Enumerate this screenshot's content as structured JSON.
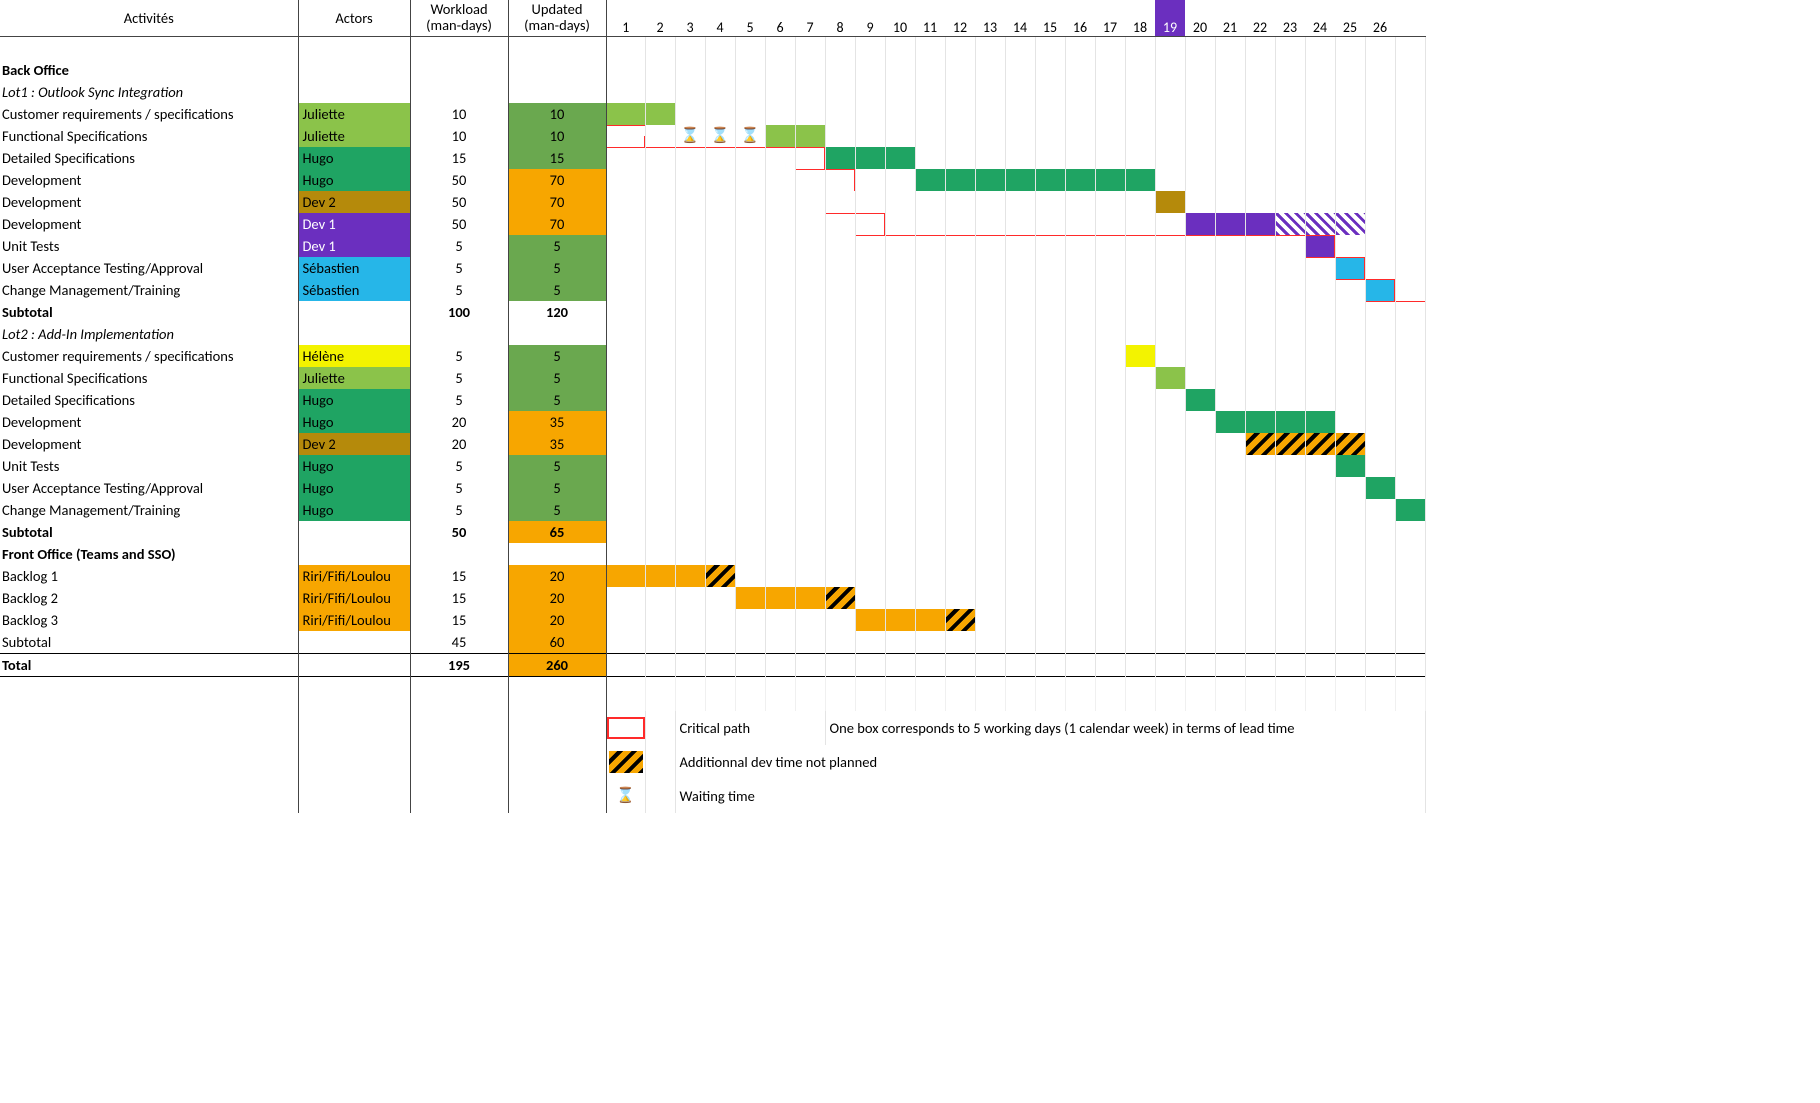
{
  "headers": {
    "activities": "Activités",
    "actors": "Actors",
    "workload": "Workload\n(man-days)",
    "updated": "Updated\n(man-days)"
  },
  "weeks": [
    "1",
    "2",
    "3",
    "4",
    "5",
    "6",
    "7",
    "8",
    "9",
    "10",
    "11",
    "12",
    "13",
    "14",
    "15",
    "16",
    "17",
    "18",
    "19",
    "20",
    "21",
    "22",
    "23",
    "24",
    "25",
    "26"
  ],
  "highlight_week_index": 18,
  "hourglass": "⌛",
  "actor_colors": {
    "Juliette": "c-lg",
    "Hugo": "c-g",
    "Dev 2": "c-ol",
    "Dev 1": "c-pu",
    "Sébastien": "c-cy",
    "Hélène": "c-ye",
    "Riri/Fifi/Loulou": "c-or"
  },
  "rows": [
    {
      "style": "empty"
    },
    {
      "style": "b",
      "act": "Back Office"
    },
    {
      "style": "i",
      "act": "Lot1 : Outlook Sync Integration"
    },
    {
      "act": "Customer requirements / specifications",
      "actor": "Juliette",
      "wl": "10",
      "upd": "10",
      "upd_bg": "c-mg",
      "bars": [
        {
          "start": 1,
          "end": 2,
          "cls": "c-lg"
        }
      ]
    },
    {
      "act": "Functional Specifications",
      "actor": "Juliette",
      "wl": "10",
      "upd": "10",
      "upd_bg": "c-mg",
      "bars": [
        {
          "start": 6,
          "end": 7,
          "cls": "c-lg"
        }
      ],
      "hourglass": [
        3,
        4,
        5
      ],
      "crit_start": 1
    },
    {
      "act": "Detailed Specifications",
      "actor": "Hugo",
      "wl": "15",
      "upd": "15",
      "upd_bg": "c-mg",
      "bars": [
        {
          "start": 8,
          "end": 10,
          "cls": "c-g"
        }
      ],
      "crit_h": {
        "from": 1,
        "to": 7
      },
      "crit_v": 7
    },
    {
      "act": "Development",
      "actor": "Hugo",
      "wl": "50",
      "upd": "70",
      "upd_bg": "c-or",
      "bars": [
        {
          "start": 11,
          "end": 18,
          "cls": "c-g"
        }
      ],
      "crit_h": {
        "from": 7,
        "to": 8
      },
      "crit_v": 8
    },
    {
      "act": "Development",
      "actor": "Dev 2",
      "wl": "50",
      "upd": "70",
      "upd_bg": "c-or",
      "bars": [
        {
          "start": 19,
          "end": 19,
          "cls": "c-ol"
        }
      ]
    },
    {
      "act": "Development",
      "actor": "Dev 1",
      "wl": "50",
      "upd": "70",
      "upd_bg": "c-or",
      "bars": [
        {
          "start": 20,
          "end": 22,
          "cls": "c-pu"
        },
        {
          "start": 23,
          "end": 25,
          "cls": "hatch-p"
        }
      ],
      "crit_h": {
        "from": 8,
        "to": 9
      },
      "crit_v": 9
    },
    {
      "act": "Unit Tests",
      "actor": "Dev 1",
      "wl": "5",
      "upd": "5",
      "upd_bg": "c-mg",
      "bars": [
        {
          "start": 24,
          "end": 24,
          "cls": "c-pu"
        }
      ],
      "crit_h": {
        "from": 9,
        "to": 24
      },
      "crit_v": 24
    },
    {
      "act": "User Acceptance Testing/Approval",
      "actor": "Sébastien",
      "wl": "5",
      "upd": "5",
      "upd_bg": "c-mg",
      "bars": [
        {
          "start": 25,
          "end": 25,
          "cls": "c-cy"
        }
      ],
      "crit_h": {
        "from": 24,
        "to": 25
      },
      "crit_v": 25
    },
    {
      "act": "Change Management/Training",
      "actor": "Sébastien",
      "wl": "5",
      "upd": "5",
      "upd_bg": "c-mg",
      "bars": [
        {
          "start": 26,
          "end": 26,
          "cls": "c-cy"
        }
      ],
      "crit_h": {
        "from": 25,
        "to": 26
      },
      "crit_v": 26
    },
    {
      "style": "b",
      "act": "Subtotal",
      "wl": "100",
      "upd": "120",
      "crit_h": {
        "from": 26,
        "to": 27
      }
    },
    {
      "style": "i",
      "act": "Lot2 : Add-In Implementation"
    },
    {
      "act": "Customer requirements / specifications",
      "actor": "Hélène",
      "wl": "5",
      "upd": "5",
      "upd_bg": "c-mg",
      "bars": [
        {
          "start": 18,
          "end": 18,
          "cls": "c-ye"
        }
      ]
    },
    {
      "act": "Functional Specifications",
      "actor": "Juliette",
      "wl": "5",
      "upd": "5",
      "upd_bg": "c-mg",
      "bars": [
        {
          "start": 19,
          "end": 19,
          "cls": "c-lg"
        }
      ]
    },
    {
      "act": "Detailed Specifications",
      "actor": "Hugo",
      "wl": "5",
      "upd": "5",
      "upd_bg": "c-mg",
      "bars": [
        {
          "start": 20,
          "end": 20,
          "cls": "c-g"
        }
      ]
    },
    {
      "act": "Development",
      "actor": "Hugo",
      "wl": "20",
      "upd": "35",
      "upd_bg": "c-or",
      "bars": [
        {
          "start": 21,
          "end": 24,
          "cls": "c-g"
        }
      ]
    },
    {
      "act": "Development",
      "actor": "Dev 2",
      "wl": "20",
      "upd": "35",
      "upd_bg": "c-or",
      "bars": [
        {
          "start": 22,
          "end": 25,
          "cls": "hatch-y"
        }
      ]
    },
    {
      "act": "Unit Tests",
      "actor": "Hugo",
      "wl": "5",
      "upd": "5",
      "upd_bg": "c-mg",
      "bars": [
        {
          "start": 25,
          "end": 25,
          "cls": "c-g"
        }
      ]
    },
    {
      "act": "User Acceptance Testing/Approval",
      "actor": "Hugo",
      "wl": "5",
      "upd": "5",
      "upd_bg": "c-mg",
      "bars": [
        {
          "start": 26,
          "end": 26,
          "cls": "c-g"
        }
      ]
    },
    {
      "act": "Change Management/Training",
      "actor": "Hugo",
      "wl": "5",
      "upd": "5",
      "upd_bg": "c-mg",
      "bars": [
        {
          "start": 27,
          "end": 27,
          "cls": "c-g"
        }
      ]
    },
    {
      "style": "b",
      "act": "Subtotal",
      "wl": "50",
      "upd": "65",
      "upd_bg": "c-or"
    },
    {
      "style": "b",
      "act": "Front Office (Teams and SSO)"
    },
    {
      "act": "Backlog 1",
      "actor": "Riri/Fifi/Loulou",
      "wl": "15",
      "upd": "20",
      "upd_bg": "c-or",
      "bars": [
        {
          "start": 1,
          "end": 3,
          "cls": "c-or"
        },
        {
          "start": 4,
          "end": 4,
          "cls": "hatch-y"
        }
      ]
    },
    {
      "act": "Backlog 2",
      "actor": "Riri/Fifi/Loulou",
      "wl": "15",
      "upd": "20",
      "upd_bg": "c-or",
      "bars": [
        {
          "start": 5,
          "end": 7,
          "cls": "c-or"
        },
        {
          "start": 8,
          "end": 8,
          "cls": "hatch-y"
        }
      ]
    },
    {
      "act": "Backlog 3",
      "actor": "Riri/Fifi/Loulou",
      "wl": "15",
      "upd": "20",
      "upd_bg": "c-or",
      "bars": [
        {
          "start": 9,
          "end": 11,
          "cls": "c-or"
        },
        {
          "start": 12,
          "end": 12,
          "cls": "hatch-y"
        }
      ]
    },
    {
      "act": "Subtotal",
      "wl": "45",
      "upd": "60",
      "upd_bg": "c-or"
    },
    {
      "style": "b",
      "act": "Total",
      "wl": "195",
      "upd": "260",
      "upd_bg": "c-or",
      "topline": true
    }
  ],
  "legend": {
    "critical": "Critical path",
    "notes": "One box corresponds to 5 working days (1 calendar week) in terms of lead time",
    "additional": "Additionnal dev time not planned",
    "waiting": "Waiting time"
  },
  "chart_data": {
    "type": "gantt",
    "title": "",
    "x_unit": "week (1 box = 5 working days)",
    "columns": [
      "Activités",
      "Actors",
      "Workload (man-days)",
      "Updated (man-days)"
    ],
    "highlight_week": 19,
    "groups": [
      {
        "name": "Back Office",
        "lots": [
          {
            "name": "Lot1 : Outlook Sync Integration",
            "tasks": [
              {
                "name": "Customer requirements / specifications",
                "actor": "Juliette",
                "workload": 10,
                "updated": 10,
                "bars": [
                  {
                    "from": 1,
                    "to": 2,
                    "kind": "plan"
                  }
                ]
              },
              {
                "name": "Functional Specifications",
                "actor": "Juliette",
                "workload": 10,
                "updated": 10,
                "bars": [
                  {
                    "from": 6,
                    "to": 7,
                    "kind": "plan"
                  }
                ],
                "waiting": [
                  3,
                  4,
                  5
                ]
              },
              {
                "name": "Detailed Specifications",
                "actor": "Hugo",
                "workload": 15,
                "updated": 15,
                "bars": [
                  {
                    "from": 8,
                    "to": 10,
                    "kind": "plan"
                  }
                ]
              },
              {
                "name": "Development",
                "actor": "Hugo",
                "workload": 50,
                "updated": 70,
                "bars": [
                  {
                    "from": 11,
                    "to": 18,
                    "kind": "plan"
                  }
                ]
              },
              {
                "name": "Development",
                "actor": "Dev 2",
                "workload": 50,
                "updated": 70,
                "bars": [
                  {
                    "from": 19,
                    "to": 19,
                    "kind": "plan"
                  }
                ]
              },
              {
                "name": "Development",
                "actor": "Dev 1",
                "workload": 50,
                "updated": 70,
                "bars": [
                  {
                    "from": 20,
                    "to": 22,
                    "kind": "plan"
                  },
                  {
                    "from": 23,
                    "to": 25,
                    "kind": "additional"
                  }
                ]
              },
              {
                "name": "Unit Tests",
                "actor": "Dev 1",
                "workload": 5,
                "updated": 5,
                "bars": [
                  {
                    "from": 24,
                    "to": 24,
                    "kind": "plan"
                  }
                ]
              },
              {
                "name": "User Acceptance Testing/Approval",
                "actor": "Sébastien",
                "workload": 5,
                "updated": 5,
                "bars": [
                  {
                    "from": 25,
                    "to": 25,
                    "kind": "plan"
                  }
                ]
              },
              {
                "name": "Change Management/Training",
                "actor": "Sébastien",
                "workload": 5,
                "updated": 5,
                "bars": [
                  {
                    "from": 26,
                    "to": 26,
                    "kind": "plan"
                  }
                ]
              }
            ],
            "subtotal": {
              "workload": 100,
              "updated": 120
            }
          },
          {
            "name": "Lot2 : Add-In Implementation",
            "tasks": [
              {
                "name": "Customer requirements / specifications",
                "actor": "Hélène",
                "workload": 5,
                "updated": 5,
                "bars": [
                  {
                    "from": 18,
                    "to": 18,
                    "kind": "plan"
                  }
                ]
              },
              {
                "name": "Functional Specifications",
                "actor": "Juliette",
                "workload": 5,
                "updated": 5,
                "bars": [
                  {
                    "from": 19,
                    "to": 19,
                    "kind": "plan"
                  }
                ]
              },
              {
                "name": "Detailed Specifications",
                "actor": "Hugo",
                "workload": 5,
                "updated": 5,
                "bars": [
                  {
                    "from": 20,
                    "to": 20,
                    "kind": "plan"
                  }
                ]
              },
              {
                "name": "Development",
                "actor": "Hugo",
                "workload": 20,
                "updated": 35,
                "bars": [
                  {
                    "from": 21,
                    "to": 24,
                    "kind": "plan"
                  }
                ]
              },
              {
                "name": "Development",
                "actor": "Dev 2",
                "workload": 20,
                "updated": 35,
                "bars": [
                  {
                    "from": 22,
                    "to": 25,
                    "kind": "additional"
                  }
                ]
              },
              {
                "name": "Unit Tests",
                "actor": "Hugo",
                "workload": 5,
                "updated": 5,
                "bars": [
                  {
                    "from": 25,
                    "to": 25,
                    "kind": "plan"
                  }
                ]
              },
              {
                "name": "User Acceptance Testing/Approval",
                "actor": "Hugo",
                "workload": 5,
                "updated": 5,
                "bars": [
                  {
                    "from": 26,
                    "to": 26,
                    "kind": "plan"
                  }
                ]
              },
              {
                "name": "Change Management/Training",
                "actor": "Hugo",
                "workload": 5,
                "updated": 5,
                "bars": [
                  {
                    "from": 27,
                    "to": 27,
                    "kind": "plan"
                  }
                ]
              }
            ],
            "subtotal": {
              "workload": 50,
              "updated": 65
            }
          }
        ]
      },
      {
        "name": "Front Office (Teams and SSO)",
        "tasks": [
          {
            "name": "Backlog 1",
            "actor": "Riri/Fifi/Loulou",
            "workload": 15,
            "updated": 20,
            "bars": [
              {
                "from": 1,
                "to": 3,
                "kind": "plan"
              },
              {
                "from": 4,
                "to": 4,
                "kind": "additional"
              }
            ]
          },
          {
            "name": "Backlog 2",
            "actor": "Riri/Fifi/Loulou",
            "workload": 15,
            "updated": 20,
            "bars": [
              {
                "from": 5,
                "to": 7,
                "kind": "plan"
              },
              {
                "from": 8,
                "to": 8,
                "kind": "additional"
              }
            ]
          },
          {
            "name": "Backlog 3",
            "actor": "Riri/Fifi/Loulou",
            "workload": 15,
            "updated": 20,
            "bars": [
              {
                "from": 9,
                "to": 11,
                "kind": "plan"
              },
              {
                "from": 12,
                "to": 12,
                "kind": "additional"
              }
            ]
          }
        ],
        "subtotal": {
          "workload": 45,
          "updated": 60
        }
      }
    ],
    "total": {
      "workload": 195,
      "updated": 260
    },
    "critical_path_weeks": [
      1,
      7,
      8,
      9,
      24,
      25,
      26
    ],
    "legend": [
      "Critical path",
      "Additionnal dev time not planned",
      "Waiting time"
    ]
  }
}
